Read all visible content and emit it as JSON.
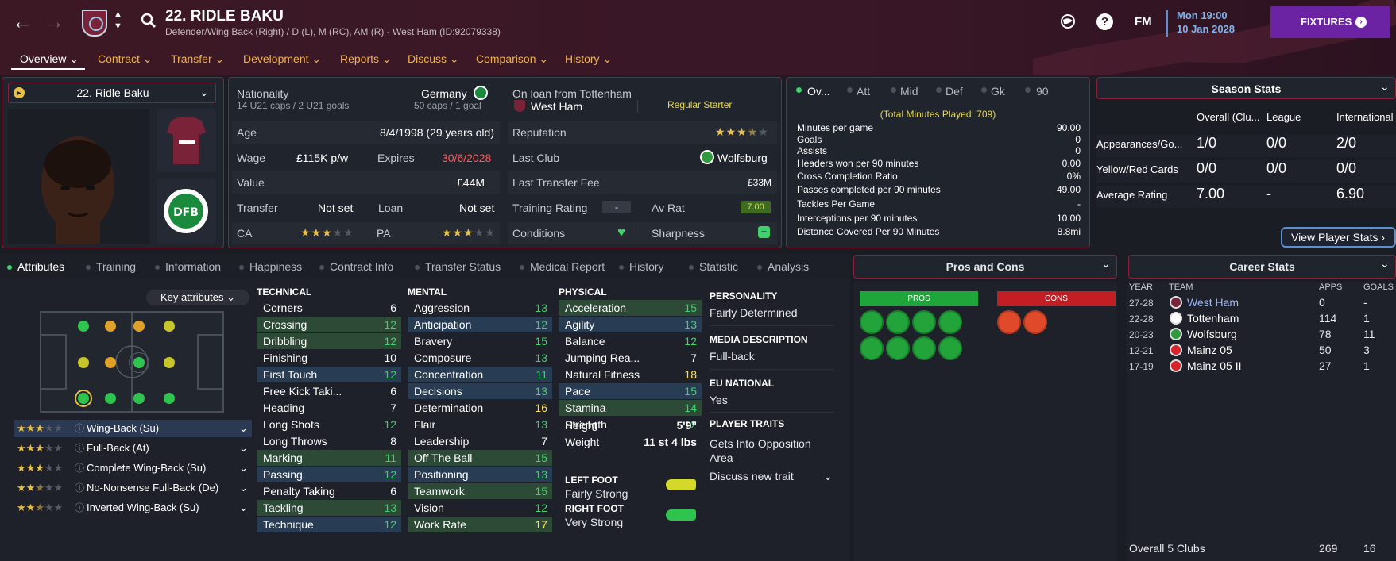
{
  "header": {
    "title": "22. RIDLE BAKU",
    "subtitle": "Defender/Wing Back (Right) / D (L), M (RC), AM (R) - West Ham (ID:92079338)",
    "day_time": "Mon 19:00",
    "date": "10 Jan 2028",
    "fixtures_label": "FIXTURES",
    "fm_label": "FM",
    "menu": [
      "Overview",
      "Contract",
      "Transfer",
      "Development",
      "Reports",
      "Discuss",
      "Comparison",
      "History"
    ]
  },
  "player_select": {
    "label": "22. Ridle Baku"
  },
  "info": {
    "nationality_label": "Nationality",
    "nationality": "Germany",
    "u21": "14 U21 caps / 2 U21 goals",
    "caps": "50 caps / 1 goal",
    "loan_label": "On loan from Tottenham",
    "loan_club": "West Ham",
    "squad_status": "Regular Starter",
    "age_label": "Age",
    "age": "8/4/1998 (29 years old)",
    "wage_label": "Wage",
    "wage": "£115K p/w",
    "expires_label": "Expires",
    "expires": "30/6/2028",
    "value_label": "Value",
    "value": "£44M",
    "transfer_label": "Transfer",
    "transfer": "Not set",
    "loan2_label": "Loan",
    "loan2": "Not set",
    "ca_label": "CA",
    "pa_label": "PA",
    "reputation_label": "Reputation",
    "last_club_label": "Last Club",
    "last_club": "Wolfsburg",
    "last_fee_label": "Last Transfer Fee",
    "last_fee": "£33M",
    "training_label": "Training Rating",
    "training": "-",
    "avrat_label": "Av Rat",
    "avrat": "7.00",
    "conditions_label": "Conditions",
    "sharpness_label": "Sharpness",
    "ca_stars": 3,
    "pa_stars": 3,
    "rep_stars": 3.5
  },
  "overview_tabs": [
    "Ov...",
    "Att",
    "Mid",
    "Def",
    "Gk",
    "90"
  ],
  "overview_stats": {
    "total": "(Total Minutes Played: 709)",
    "rows": [
      {
        "label": "Minutes per game",
        "value": "90.00"
      },
      {
        "label": "Goals",
        "value": "0"
      },
      {
        "label": "Assists",
        "value": "0"
      },
      {
        "label": "Headers won per 90 minutes",
        "value": "0.00"
      },
      {
        "label": "Cross Completion Ratio",
        "value": "0%"
      },
      {
        "label": "Passes completed per 90 minutes",
        "value": "49.00"
      },
      {
        "label": "Tackles Per Game",
        "value": "-"
      },
      {
        "label": "Interceptions per 90 minutes",
        "value": "10.00"
      },
      {
        "label": "Distance Covered Per 90 Minutes",
        "value": "8.8mi"
      }
    ]
  },
  "season_stats": {
    "title": "Season Stats",
    "cols": [
      "Overall (Clu...",
      "League",
      "International"
    ],
    "rows": [
      {
        "label": "Appearances/Go...",
        "v": [
          "1/0",
          "0/0",
          "2/0"
        ]
      },
      {
        "label": "Yellow/Red Cards",
        "v": [
          "0/0",
          "0/0",
          "0/0"
        ]
      },
      {
        "label": "Average Rating",
        "v": [
          "7.00",
          "-",
          "6.90"
        ]
      }
    ],
    "view_btn": "View Player Stats"
  },
  "tabs": [
    "Attributes",
    "Training",
    "Information",
    "Happiness",
    "Contract Info",
    "Transfer Status",
    "Medical Report",
    "History",
    "Statistic",
    "Analysis"
  ],
  "key_attr": "Key attributes",
  "roles": [
    {
      "name": "Wing-Back (Su)",
      "stars": 3
    },
    {
      "name": "Full-Back (At)",
      "stars": 3
    },
    {
      "name": "Complete Wing-Back (Su)",
      "stars": 3
    },
    {
      "name": "No-Nonsense Full-Back (De)",
      "stars": 2.5
    },
    {
      "name": "Inverted Wing-Back (Su)",
      "stars": 2.5
    }
  ],
  "technical": {
    "title": "TECHNICAL",
    "rows": [
      {
        "n": "Corners",
        "v": "6",
        "h": ""
      },
      {
        "n": "Crossing",
        "v": "12",
        "h": "g"
      },
      {
        "n": "Dribbling",
        "v": "12",
        "h": "g"
      },
      {
        "n": "Finishing",
        "v": "10",
        "h": ""
      },
      {
        "n": "First Touch",
        "v": "12",
        "h": "b"
      },
      {
        "n": "Free Kick Taki...",
        "v": "6",
        "h": ""
      },
      {
        "n": "Heading",
        "v": "7",
        "h": ""
      },
      {
        "n": "Long Shots",
        "v": "12",
        "h": ""
      },
      {
        "n": "Long Throws",
        "v": "8",
        "h": ""
      },
      {
        "n": "Marking",
        "v": "11",
        "h": "g"
      },
      {
        "n": "Passing",
        "v": "12",
        "h": "b"
      },
      {
        "n": "Penalty Taking",
        "v": "6",
        "h": ""
      },
      {
        "n": "Tackling",
        "v": "13",
        "h": "g"
      },
      {
        "n": "Technique",
        "v": "12",
        "h": "b"
      }
    ]
  },
  "mental": {
    "title": "MENTAL",
    "rows": [
      {
        "n": "Aggression",
        "v": "13",
        "h": ""
      },
      {
        "n": "Anticipation",
        "v": "12",
        "h": "b"
      },
      {
        "n": "Bravery",
        "v": "15",
        "h": ""
      },
      {
        "n": "Composure",
        "v": "13",
        "h": ""
      },
      {
        "n": "Concentration",
        "v": "11",
        "h": "b"
      },
      {
        "n": "Decisions",
        "v": "13",
        "h": "b"
      },
      {
        "n": "Determination",
        "v": "16",
        "h": ""
      },
      {
        "n": "Flair",
        "v": "13",
        "h": ""
      },
      {
        "n": "Leadership",
        "v": "7",
        "h": ""
      },
      {
        "n": "Off The Ball",
        "v": "15",
        "h": "g"
      },
      {
        "n": "Positioning",
        "v": "13",
        "h": "b"
      },
      {
        "n": "Teamwork",
        "v": "15",
        "h": "g"
      },
      {
        "n": "Vision",
        "v": "12",
        "h": ""
      },
      {
        "n": "Work Rate",
        "v": "17",
        "h": "g"
      }
    ]
  },
  "physical": {
    "title": "PHYSICAL",
    "rows": [
      {
        "n": "Acceleration",
        "v": "15",
        "h": "g"
      },
      {
        "n": "Agility",
        "v": "13",
        "h": "b"
      },
      {
        "n": "Balance",
        "v": "12",
        "h": ""
      },
      {
        "n": "Jumping Rea...",
        "v": "7",
        "h": ""
      },
      {
        "n": "Natural Fitness",
        "v": "18",
        "h": ""
      },
      {
        "n": "Pace",
        "v": "15",
        "h": "b"
      },
      {
        "n": "Stamina",
        "v": "14",
        "h": "g"
      },
      {
        "n": "Strength",
        "v": "12",
        "h": ""
      }
    ]
  },
  "height_label": "Height",
  "height": "5'9\"",
  "weight_label": "Weight",
  "weight": "11 st 4 lbs",
  "left_foot_label": "LEFT FOOT",
  "left_foot": "Fairly Strong",
  "right_foot_label": "RIGHT FOOT",
  "right_foot": "Very Strong",
  "personality_label": "PERSONALITY",
  "personality": "Fairly Determined",
  "media_label": "MEDIA DESCRIPTION",
  "media": "Full-back",
  "eu_label": "EU NATIONAL",
  "eu": "Yes",
  "traits_label": "PLAYER TRAITS",
  "traits": "Gets Into Opposition Area",
  "discuss_trait": "Discuss new trait",
  "pros_cons": {
    "title": "Pros and Cons",
    "pros": "PROS",
    "cons": "CONS"
  },
  "career": {
    "title": "Career Stats",
    "cols": [
      "YEAR",
      "TEAM",
      "APPS",
      "GOALS"
    ],
    "rows": [
      {
        "year": "27-28",
        "team": "West Ham",
        "apps": "0",
        "goals": "-"
      },
      {
        "year": "22-28",
        "team": "Tottenham",
        "apps": "114",
        "goals": "1"
      },
      {
        "year": "20-23",
        "team": "Wolfsburg",
        "apps": "78",
        "goals": "11"
      },
      {
        "year": "12-21",
        "team": "Mainz 05",
        "apps": "50",
        "goals": "3"
      },
      {
        "year": "17-19",
        "team": "Mainz 05 II",
        "apps": "27",
        "goals": "1"
      }
    ],
    "total_label": "Overall 5 Clubs",
    "total_apps": "269",
    "total_goals": "16"
  },
  "colors": {
    "accent": "#6b23a3",
    "header": "#3c1824",
    "highlight_green": "#2d4a37",
    "highlight_blue": "#283c54",
    "gold": "#f0b24b"
  }
}
